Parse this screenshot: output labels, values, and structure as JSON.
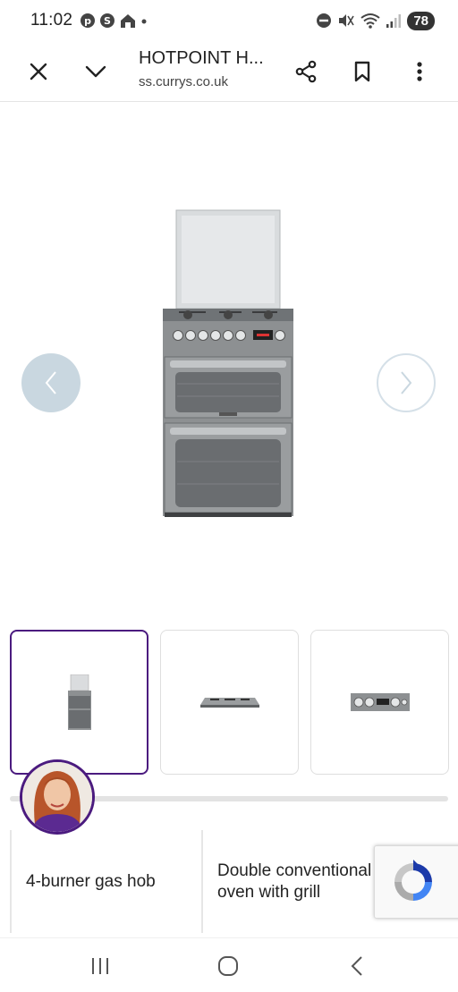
{
  "status_bar": {
    "time": "11:02",
    "battery": "78",
    "left_icons": [
      "pinterest-icon",
      "s-circle-icon",
      "home-icon",
      "dot-icon"
    ],
    "right_icons": [
      "do-not-disturb-icon",
      "mute-icon",
      "wifi-icon",
      "signal-icon"
    ]
  },
  "browser": {
    "title": "HOTPOINT H...",
    "url": "ss.currys.co.uk",
    "actions": [
      "close-icon",
      "chevron-down-icon",
      "share-icon",
      "bookmark-icon",
      "more-vert-icon"
    ]
  },
  "gallery": {
    "thumbnails": [
      "cooker-front-thumb",
      "gas-hob-thumb",
      "control-panel-thumb"
    ],
    "selected_index": 0,
    "scroll_progress": 0.2
  },
  "features": [
    "4-burner gas hob",
    "Double conventional oven with grill"
  ],
  "colors": {
    "brand_purple": "#4b1b7f",
    "arrow_disabled": "#c9d7e0",
    "appliance_gray": "#8d9092"
  }
}
